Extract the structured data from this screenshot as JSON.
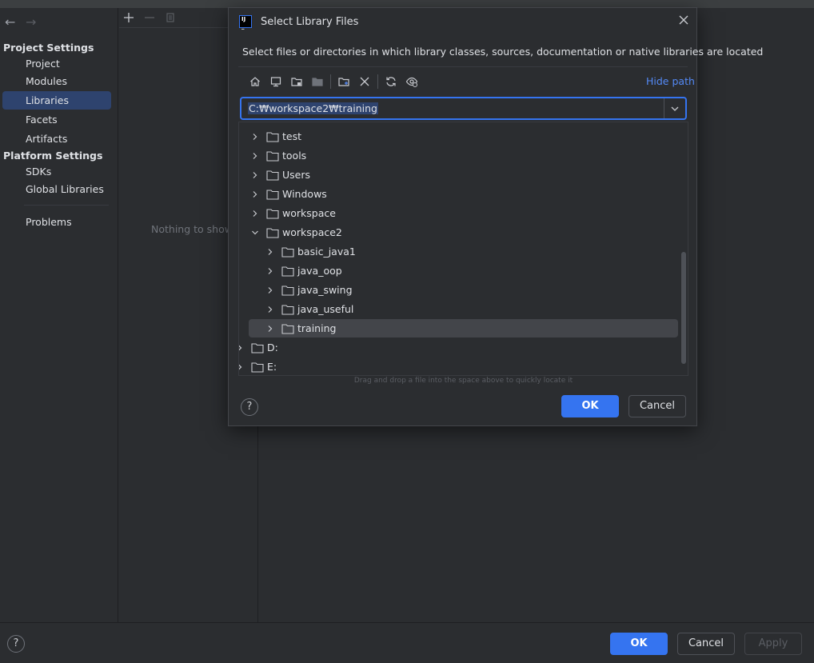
{
  "nav": {
    "back_icon": "arrow-left-icon",
    "forward_icon": "arrow-right-icon",
    "project_settings_title": "Project Settings",
    "platform_settings_title": "Platform Settings",
    "items": {
      "project": "Project",
      "modules": "Modules",
      "libraries": "Libraries",
      "facets": "Facets",
      "artifacts": "Artifacts",
      "sdks": "SDKs",
      "global_libraries": "Global Libraries",
      "problems": "Problems"
    },
    "selected": "Libraries"
  },
  "middle": {
    "toolbar_icons": [
      "add-icon",
      "remove-icon",
      "copy-icon"
    ],
    "empty_text": "Nothing to show"
  },
  "bottom": {
    "help": "?",
    "ok": "OK",
    "cancel": "Cancel",
    "apply": "Apply"
  },
  "dialog": {
    "title": "Select Library Files",
    "description": "Select files or directories in which library classes, sources, documentation or native libraries are located",
    "hide_path": "Hide path",
    "path_value": "C:₩workspace2₩training",
    "toolbar_icons": [
      "home-icon",
      "desktop-icon",
      "project-folder-icon",
      "module-folder-icon",
      "new-folder-icon",
      "delete-icon",
      "refresh-icon",
      "show-hidden-icon"
    ],
    "tree": {
      "test": "test",
      "tools": "tools",
      "users": "Users",
      "windows": "Windows",
      "workspace": "workspace",
      "workspace2": "workspace2",
      "basic_java1": "basic_java1",
      "java_oop": "java_oop",
      "java_swing": "java_swing",
      "java_useful": "java_useful",
      "training": "training",
      "drive_d": "D:",
      "drive_e": "E:"
    },
    "selected_node": "training",
    "drag_hint": "Drag and drop a file into the space above to quickly locate it",
    "help": "?",
    "ok": "OK",
    "cancel": "Cancel"
  },
  "colors": {
    "accent": "#3574f0",
    "background": "#2b2d30",
    "selection": "#2e436e",
    "link": "#548af7"
  }
}
